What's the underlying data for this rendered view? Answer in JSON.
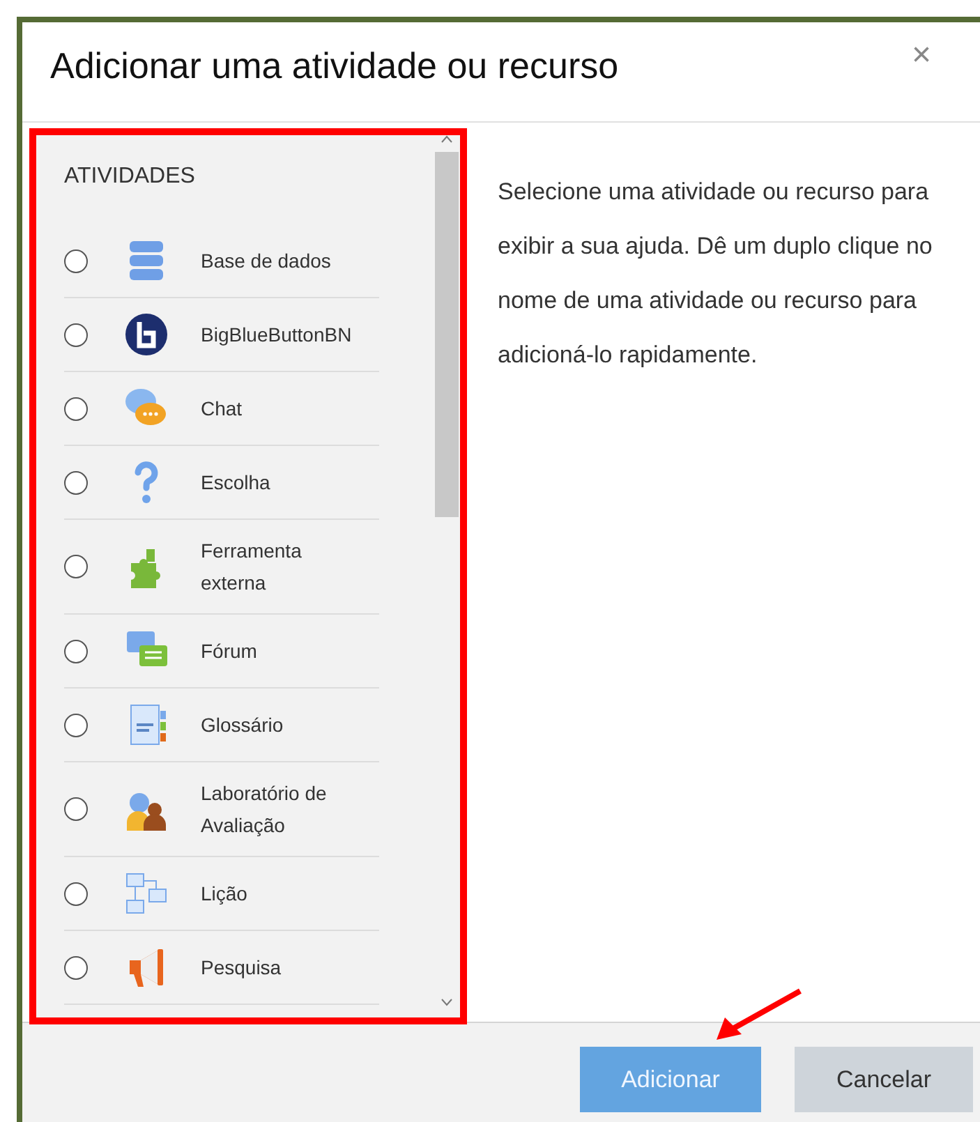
{
  "dialog": {
    "title": "Adicionar uma atividade ou recurso",
    "close": "×"
  },
  "section": {
    "heading": "ATIVIDADES"
  },
  "items": [
    {
      "kind": "database",
      "label": "Base de dados",
      "selected": false
    },
    {
      "kind": "bigbluebutton",
      "label": "BigBlueButtonBN",
      "selected": false
    },
    {
      "kind": "chat",
      "label": "Chat",
      "selected": false
    },
    {
      "kind": "choice",
      "label": "Escolha",
      "selected": false
    },
    {
      "kind": "puzzle",
      "label": "Ferramenta externa",
      "selected": false
    },
    {
      "kind": "forum",
      "label": "Fórum",
      "selected": false
    },
    {
      "kind": "glossary",
      "label": "Glossário",
      "selected": false
    },
    {
      "kind": "workshop",
      "label": "Laboratório de Avaliação",
      "selected": false
    },
    {
      "kind": "lesson",
      "label": "Lição",
      "selected": false
    },
    {
      "kind": "megaphone",
      "label": "Pesquisa",
      "selected": false
    }
  ],
  "help": "Selecione uma atividade ou recurso para exibir a sua ajuda. Dê um duplo clique no nome de uma atividade ou recurso para adicioná-lo rapidamente.",
  "buttons": [
    {
      "kind": "primary",
      "label": "Adicionar"
    },
    {
      "kind": "secondary",
      "label": "Cancelar"
    }
  ]
}
